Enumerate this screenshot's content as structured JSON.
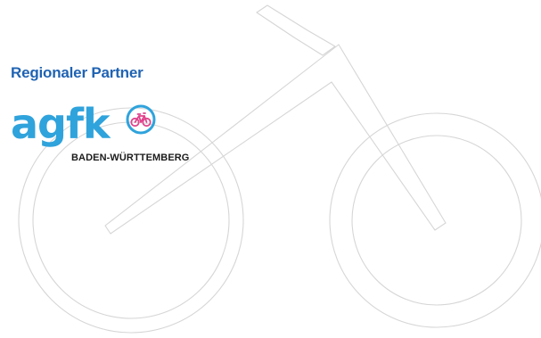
{
  "partner_section": {
    "heading": "Regionaler Partner"
  },
  "logo": {
    "wordmark": "agfk",
    "region": "BADEN-WÜRTTEMBERG",
    "primary_color": "#2fa3dc",
    "badge_icon": "bicycle-icon",
    "badge_color": "#e0438c"
  },
  "background": {
    "illustration": "bicycle-outline-illustration",
    "line_color": "#d6d6d6"
  },
  "colors": {
    "heading": "#1f63b3"
  }
}
